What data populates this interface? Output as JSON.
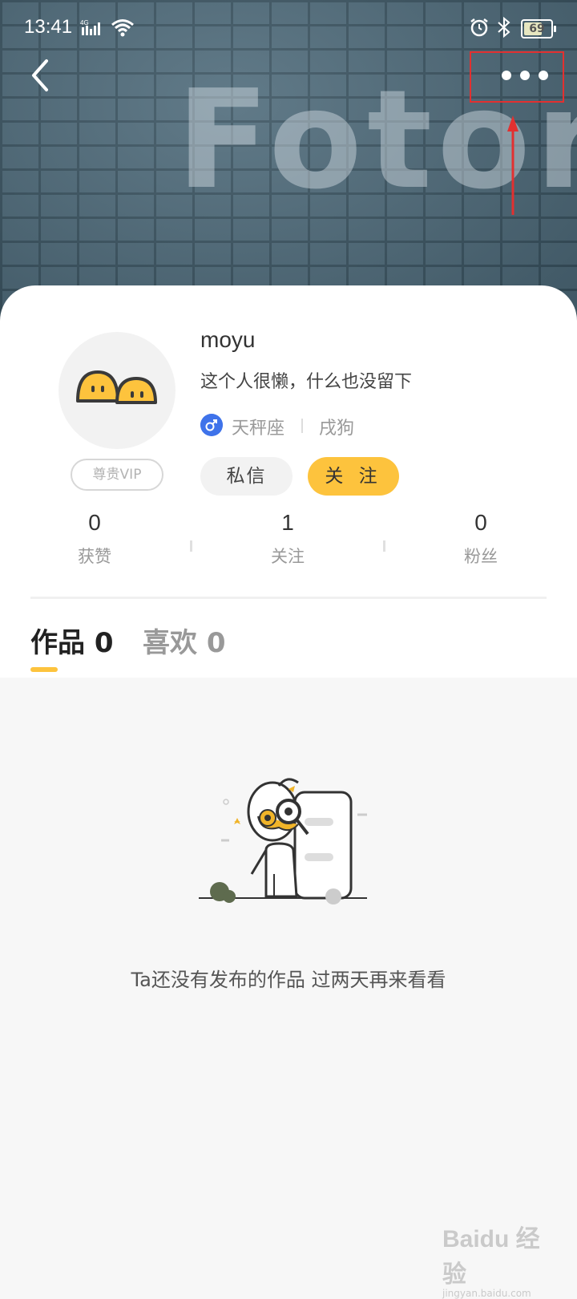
{
  "status_bar": {
    "time": "13:41",
    "network": "4G",
    "battery": "69"
  },
  "header": {
    "graffiti_text": "Fotor"
  },
  "profile": {
    "username": "moyu",
    "bio": "这个人很懒，什么也没留下",
    "gender": "male",
    "zodiac": "天秤座",
    "chinese_zodiac": "戌狗",
    "vip_label": "尊贵VIP",
    "message_button": "私信",
    "follow_button": "关 注"
  },
  "stats": [
    {
      "value": "0",
      "label": "获赞"
    },
    {
      "value": "1",
      "label": "关注"
    },
    {
      "value": "0",
      "label": "粉丝"
    }
  ],
  "tabs": [
    {
      "label": "作品 0",
      "active": true
    },
    {
      "label": "喜欢 0",
      "active": false
    }
  ],
  "empty_state": {
    "text": "Ta还没有发布的作品 过两天再来看看"
  },
  "watermark": {
    "brand": "Baidu 经验",
    "url": "jingyan.baidu.com"
  },
  "colors": {
    "accent": "#fdc33d",
    "highlight": "#e23030",
    "gender_male": "#3f73ea"
  }
}
